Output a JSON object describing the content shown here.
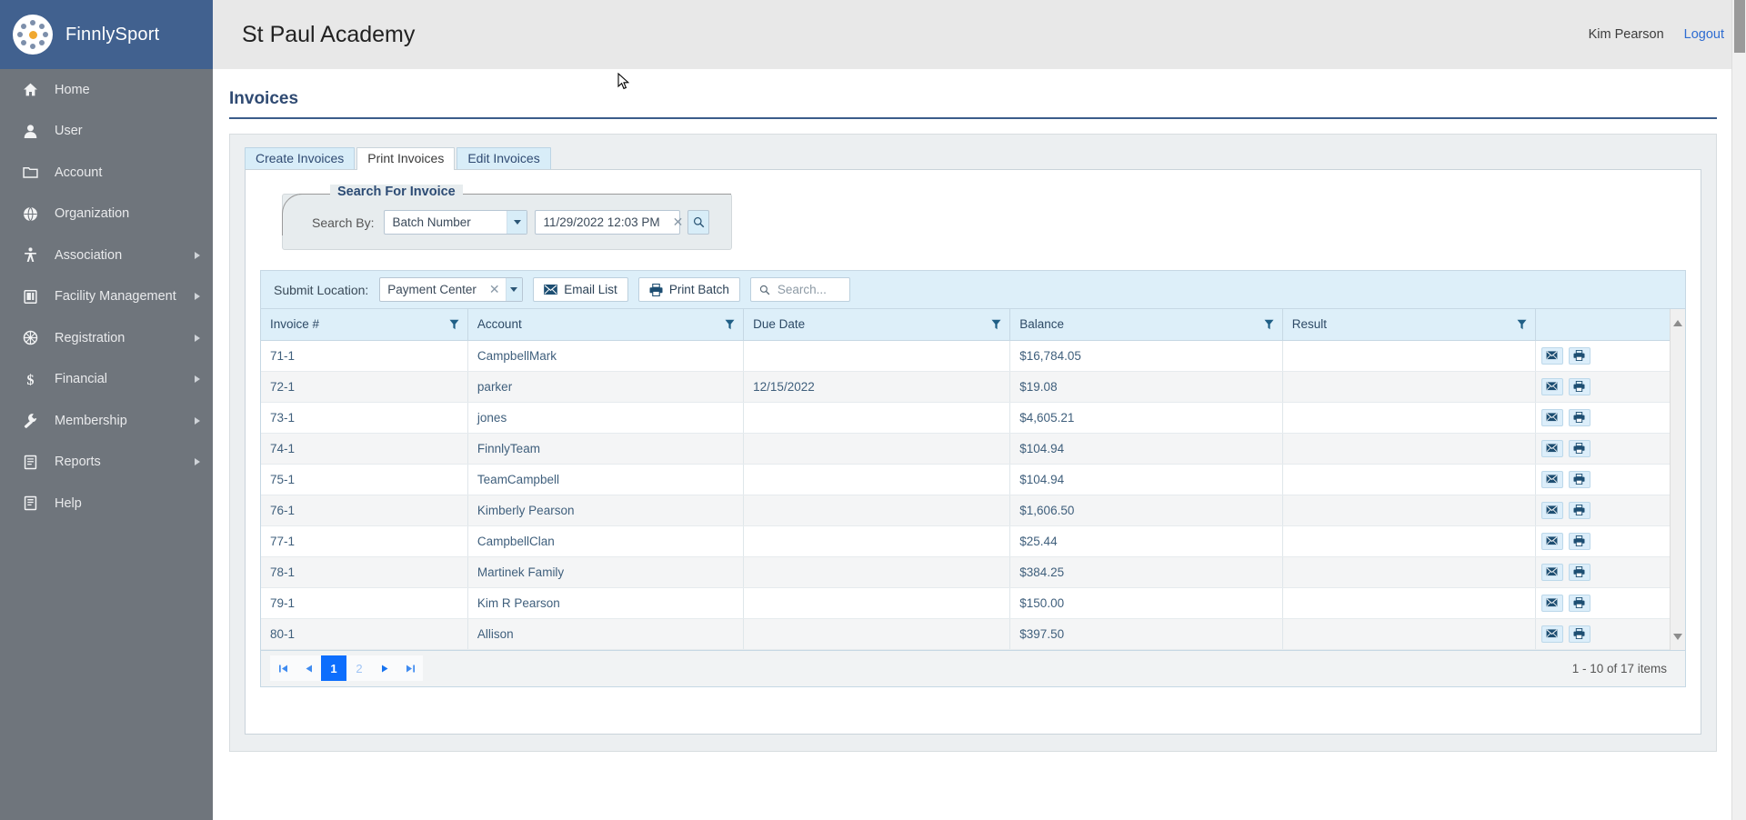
{
  "brand": {
    "name": "FinnlySport",
    "logo_icon": "finnly-circle-logo"
  },
  "topbar": {
    "org_title": "St Paul Academy",
    "user_name": "Kim Pearson",
    "logout_label": "Logout"
  },
  "sidebar": {
    "items": [
      {
        "label": "Home",
        "icon": "home-icon",
        "has_submenu": false
      },
      {
        "label": "User",
        "icon": "user-icon",
        "has_submenu": false
      },
      {
        "label": "Account",
        "icon": "folder-icon",
        "has_submenu": false
      },
      {
        "label": "Organization",
        "icon": "globe-icon",
        "has_submenu": false
      },
      {
        "label": "Association",
        "icon": "person-icon",
        "has_submenu": true
      },
      {
        "label": "Facility Management",
        "icon": "building-icon",
        "has_submenu": true
      },
      {
        "label": "Registration",
        "icon": "wheel-icon",
        "has_submenu": true
      },
      {
        "label": "Financial",
        "icon": "dollar-icon",
        "has_submenu": true
      },
      {
        "label": "Membership",
        "icon": "wrench-icon",
        "has_submenu": true
      },
      {
        "label": "Reports",
        "icon": "report-icon",
        "has_submenu": true
      },
      {
        "label": "Help",
        "icon": "help-book-icon",
        "has_submenu": false
      }
    ]
  },
  "page": {
    "title": "Invoices"
  },
  "tabs": [
    {
      "label": "Create Invoices",
      "active": false
    },
    {
      "label": "Print Invoices",
      "active": true
    },
    {
      "label": "Edit Invoices",
      "active": false
    }
  ],
  "search_panel": {
    "legend": "Search For Invoice",
    "search_by_label": "Search By:",
    "search_by_value": "Batch Number",
    "date_value": "11/29/2022 12:03 PM",
    "search_button_icon": "magnifier-icon",
    "clear_icon": "close-x-icon",
    "dropdown_icon": "chevron-down-icon"
  },
  "grid_toolbar": {
    "submit_location_label": "Submit Location:",
    "submit_location_value": "Payment Center",
    "email_list_label": "Email List",
    "email_list_icon": "envelope-icon",
    "print_batch_label": "Print Batch",
    "print_batch_icon": "printer-icon",
    "search_placeholder": "Search...",
    "search_value": "",
    "search_icon": "magnifier-icon"
  },
  "grid": {
    "columns": [
      {
        "label": "Invoice #",
        "filter_icon": "filter-icon"
      },
      {
        "label": "Account",
        "filter_icon": "filter-icon"
      },
      {
        "label": "Due Date",
        "filter_icon": "filter-icon"
      },
      {
        "label": "Balance",
        "filter_icon": "filter-icon"
      },
      {
        "label": "Result",
        "filter_icon": "filter-icon"
      },
      {
        "label": "",
        "filter_icon": ""
      }
    ],
    "rows": [
      {
        "invoice": "71-1",
        "account": "CampbellMark",
        "due_date": "",
        "balance": "$16,784.05",
        "result": ""
      },
      {
        "invoice": "72-1",
        "account": "parker",
        "due_date": "12/15/2022",
        "balance": "$19.08",
        "result": ""
      },
      {
        "invoice": "73-1",
        "account": "jones",
        "due_date": "",
        "balance": "$4,605.21",
        "result": ""
      },
      {
        "invoice": "74-1",
        "account": "FinnlyTeam",
        "due_date": "",
        "balance": "$104.94",
        "result": ""
      },
      {
        "invoice": "75-1",
        "account": "TeamCampbell",
        "due_date": "",
        "balance": "$104.94",
        "result": ""
      },
      {
        "invoice": "76-1",
        "account": "Kimberly Pearson",
        "due_date": "",
        "balance": "$1,606.50",
        "result": ""
      },
      {
        "invoice": "77-1",
        "account": "CampbellClan",
        "due_date": "",
        "balance": "$25.44",
        "result": ""
      },
      {
        "invoice": "78-1",
        "account": "Martinek Family",
        "due_date": "",
        "balance": "$384.25",
        "result": ""
      },
      {
        "invoice": "79-1",
        "account": "Kim R Pearson",
        "due_date": "",
        "balance": "$150.00",
        "result": ""
      },
      {
        "invoice": "80-1",
        "account": "Allison",
        "due_date": "",
        "balance": "$397.50",
        "result": ""
      }
    ],
    "row_actions": [
      {
        "icon": "envelope-icon",
        "name": "email-invoice-button"
      },
      {
        "icon": "printer-icon",
        "name": "print-invoice-button"
      }
    ]
  },
  "pager": {
    "first_icon": "first-page-icon",
    "prev_icon": "prev-page-icon",
    "pages": [
      "1",
      "2"
    ],
    "current_page": "1",
    "next_icon": "next-page-icon",
    "last_icon": "last-page-icon",
    "status": "1 - 10 of 17 items"
  },
  "colors": {
    "brand_blue": "#41618f",
    "sidebar_gray": "#6f757c",
    "accent_header": "#ddeff9",
    "pager_active": "#0d6efd",
    "link_blue": "#2e6cd1"
  }
}
